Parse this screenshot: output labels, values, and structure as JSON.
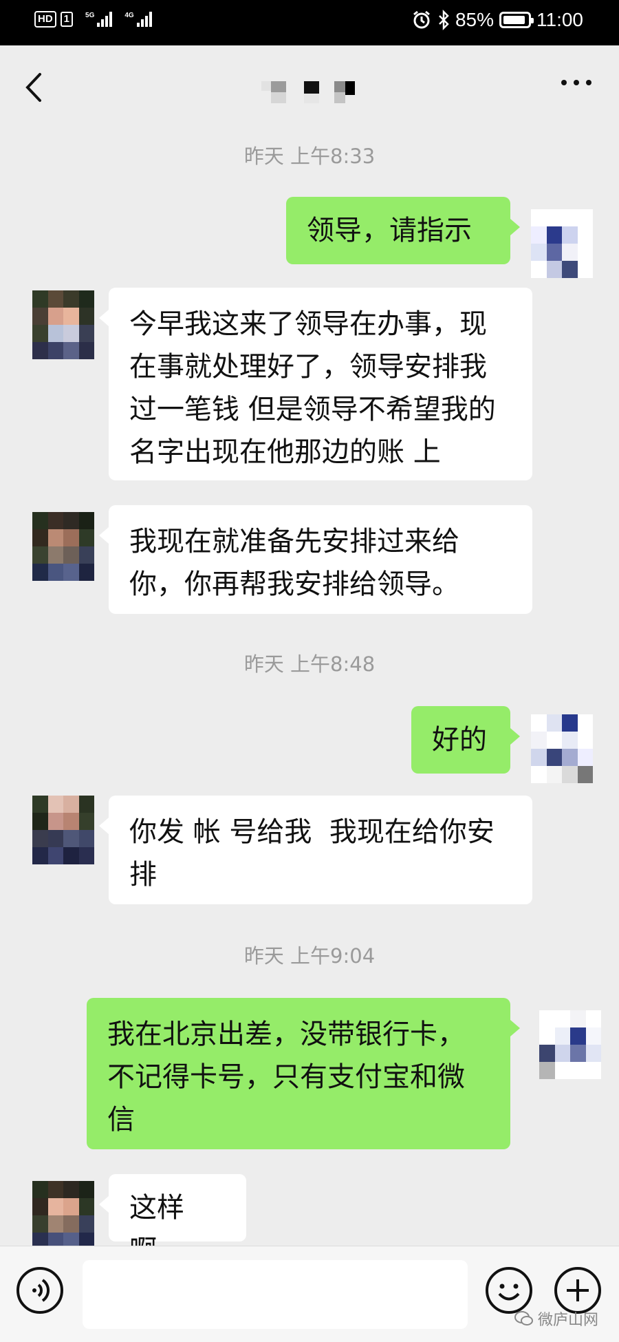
{
  "status_bar": {
    "hd": "HD",
    "sim": "1",
    "net1": "5G",
    "net2": "4G",
    "battery": "85%",
    "time": "11:00"
  },
  "header": {
    "title": ""
  },
  "messages": [
    {
      "type": "timestamp",
      "text": "昨天 上午8:33"
    },
    {
      "type": "sent",
      "text": "领导，请指示"
    },
    {
      "type": "received",
      "text": "今早我这来了领导在办事，现在事就处理好了，领导安排我过一笔钱 但是领导不希望我的名字出现在他那边的账 上"
    },
    {
      "type": "received",
      "text": "我现在就准备先安排过来给你，你再帮我安排给领导。"
    },
    {
      "type": "timestamp",
      "text": "昨天 上午8:48"
    },
    {
      "type": "sent",
      "text": "好的"
    },
    {
      "type": "received",
      "text": "你发 帐 号给我  我现在给你安排"
    },
    {
      "type": "timestamp",
      "text": "昨天 上午9:04"
    },
    {
      "type": "sent",
      "text": "我在北京出差，没带银行卡，不记得卡号，只有支付宝和微信"
    },
    {
      "type": "received",
      "text": "这样啊，"
    }
  ],
  "input": {
    "value": "",
    "placeholder": ""
  },
  "watermark": "微庐山网",
  "colors": {
    "sent_bubble": "#95ec69",
    "received_bubble": "#ffffff",
    "background": "#ededed"
  }
}
